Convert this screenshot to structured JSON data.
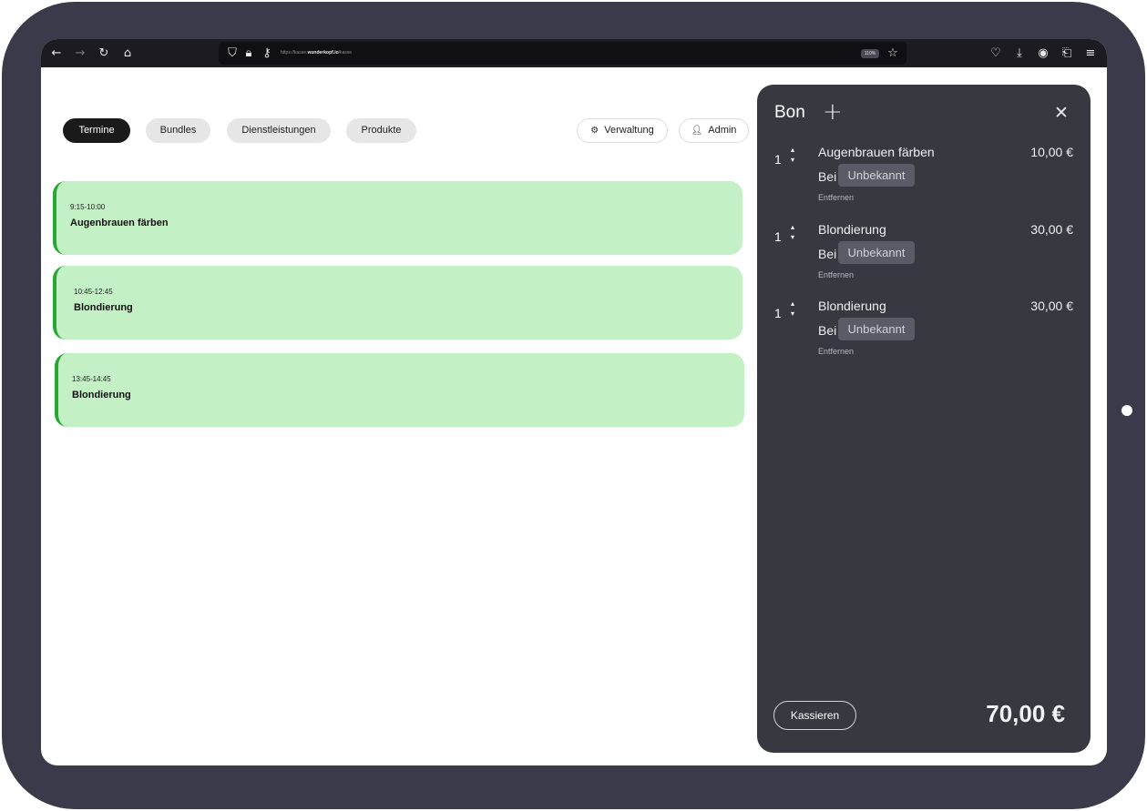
{
  "browser": {
    "url_prefix": "https://kasse.",
    "url_domain": "wunderkopf.io",
    "url_path": "/kasse",
    "zoom": "110%",
    "icons": {
      "back": "arrow-left-icon",
      "forward": "arrow-right-icon",
      "reload": "reload-icon",
      "home": "home-icon",
      "shield": "shield-icon",
      "lock": "lock-icon",
      "key": "key-icon",
      "star": "star-icon",
      "pocket": "pocket-icon",
      "download": "download-icon",
      "account": "account-icon",
      "extensions": "extensions-icon",
      "menu": "menu-icon"
    }
  },
  "nav": {
    "tabs": [
      {
        "label": "Termine",
        "active": true
      },
      {
        "label": "Bundles",
        "active": false
      },
      {
        "label": "Dienstleistungen",
        "active": false
      },
      {
        "label": "Produkte",
        "active": false
      }
    ],
    "verwaltung_label": "Verwaltung",
    "admin_label": "Admin"
  },
  "appointments": [
    {
      "time": "9:15-10:00",
      "title": "Augenbrauen färben"
    },
    {
      "time": "10:45-12:45",
      "title": "Blondierung"
    },
    {
      "time": "13:45-14:45",
      "title": "Blondierung"
    }
  ],
  "bon": {
    "title": "Bon",
    "add_symbol": "+",
    "close_symbol": "✕",
    "items": [
      {
        "qty": "1",
        "name": "Augenbrauen färben",
        "price": "10,00 €",
        "bei": "Bei",
        "staff": "Unbekannt",
        "remove": "Entfernen"
      },
      {
        "qty": "1",
        "name": "Blondierung",
        "price": "30,00 €",
        "bei": "Bei",
        "staff": "Unbekannt",
        "remove": "Entfernen"
      },
      {
        "qty": "1",
        "name": "Blondierung",
        "price": "30,00 €",
        "bei": "Bei",
        "staff": "Unbekannt",
        "remove": "Entfernen"
      }
    ],
    "checkout_label": "Kassieren",
    "total": "70,00 €"
  },
  "colors": {
    "frame": "#3b3a4a",
    "panel": "#383841",
    "appointment_bg": "#c3f0c5",
    "appointment_accent": "#27a833",
    "active_tab": "#1a1a1a"
  }
}
